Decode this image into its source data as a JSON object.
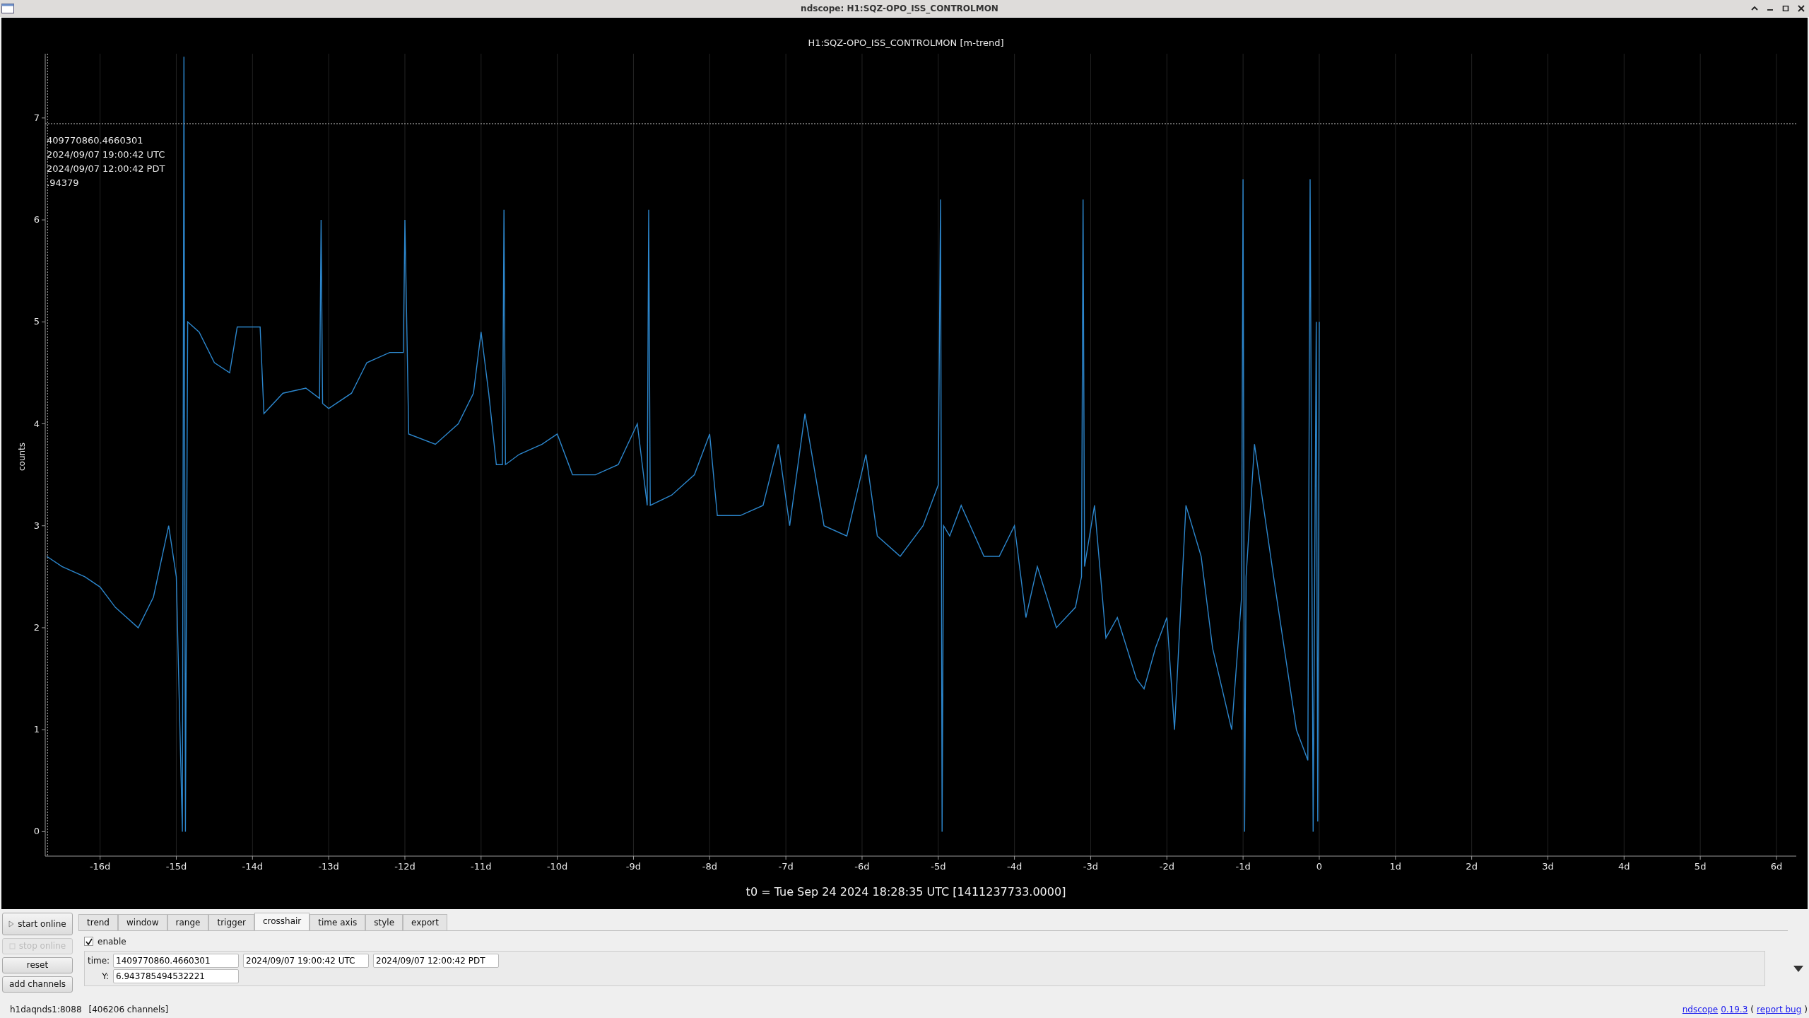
{
  "window": {
    "title": "ndscope: H1:SQZ-OPO_ISS_CONTROLMON"
  },
  "plot": {
    "crosshair_readouts": [
      "409770860.4660301",
      "2024/09/07 19:00:42 UTC",
      "2024/09/07 12:00:42 PDT",
      ".94379"
    ],
    "chart_data": {
      "type": "line",
      "title": "H1:SQZ-OPO_ISS_CONTROLMON [m-trend]",
      "ylabel": "counts",
      "xlabel": "t0 = Tue Sep 24 2024 18:28:35 UTC [1411237733.0000]",
      "xlim": [
        -16.72,
        6.26
      ],
      "ylim": [
        -0.24,
        7.63
      ],
      "yticks": [
        0,
        1,
        2,
        3,
        4,
        5,
        6,
        7
      ],
      "grid": true,
      "ref_lines": [
        {
          "axis": "y",
          "value": 6.9438
        },
        {
          "axis": "x",
          "value": -16.69
        }
      ],
      "xticks": [
        {
          "value": -16,
          "label": "-16d"
        },
        {
          "value": -15,
          "label": "-15d"
        },
        {
          "value": -14,
          "label": "-14d"
        },
        {
          "value": -13,
          "label": "-13d"
        },
        {
          "value": -12,
          "label": "-12d"
        },
        {
          "value": -11,
          "label": "-11d"
        },
        {
          "value": -10,
          "label": "-10d"
        },
        {
          "value": -9,
          "label": "-9d"
        },
        {
          "value": -8,
          "label": "-8d"
        },
        {
          "value": -7,
          "label": "-7d"
        },
        {
          "value": -6,
          "label": "-6d"
        },
        {
          "value": -5,
          "label": "-5d"
        },
        {
          "value": -4,
          "label": "-4d"
        },
        {
          "value": -3,
          "label": "-3d"
        },
        {
          "value": -2,
          "label": "-2d"
        },
        {
          "value": -1,
          "label": "-1d"
        },
        {
          "value": 0,
          "label": "0"
        },
        {
          "value": 1,
          "label": "1d"
        },
        {
          "value": 2,
          "label": "2d"
        },
        {
          "value": 3,
          "label": "3d"
        },
        {
          "value": 4,
          "label": "4d"
        },
        {
          "value": 5,
          "label": "5d"
        },
        {
          "value": 6,
          "label": "6d"
        }
      ],
      "x": [
        -16.7,
        -16.5,
        -16.2,
        -16,
        -15.8,
        -15.5,
        -15.3,
        -15.1,
        -15.0,
        -14.92,
        -14.9,
        -14.88,
        -14.85,
        -14.7,
        -14.5,
        -14.3,
        -14.2,
        -13.9,
        -13.85,
        -13.6,
        -13.3,
        -13.12,
        -13.1,
        -13.08,
        -13.0,
        -12.7,
        -12.5,
        -12.2,
        -12.02,
        -12.0,
        -11.95,
        -11.6,
        -11.3,
        -11.1,
        -11.0,
        -10.9,
        -10.8,
        -10.72,
        -10.7,
        -10.68,
        -10.5,
        -10.2,
        -10.0,
        -9.8,
        -9.5,
        -9.2,
        -8.95,
        -8.82,
        -8.8,
        -8.78,
        -8.5,
        -8.2,
        -8.0,
        -7.9,
        -7.6,
        -7.3,
        -7.1,
        -6.95,
        -6.75,
        -6.5,
        -6.2,
        -5.95,
        -5.8,
        -5.5,
        -5.2,
        -5.0,
        -4.97,
        -4.95,
        -4.93,
        -4.85,
        -4.7,
        -4.4,
        -4.2,
        -4.0,
        -3.85,
        -3.7,
        -3.45,
        -3.2,
        -3.12,
        -3.1,
        -3.08,
        -2.95,
        -2.8,
        -2.65,
        -2.4,
        -2.3,
        -2.15,
        -2.0,
        -1.9,
        -1.75,
        -1.55,
        -1.4,
        -1.15,
        -1.02,
        -1.0,
        -0.98,
        -0.96,
        -0.85,
        -0.6,
        -0.3,
        -0.15,
        -0.12,
        -0.08,
        -0.04,
        -0.02,
        0.0
      ],
      "series": [
        {
          "color": "#2c86cc",
          "values": [
            2.7,
            2.6,
            2.5,
            2.4,
            2.2,
            2.0,
            2.3,
            3.0,
            2.5,
            0.0,
            7.6,
            0.0,
            5.0,
            4.9,
            4.6,
            4.5,
            4.95,
            4.95,
            4.1,
            4.3,
            4.35,
            4.25,
            6.0,
            4.2,
            4.15,
            4.3,
            4.6,
            4.7,
            4.7,
            6.0,
            3.9,
            3.8,
            4.0,
            4.3,
            4.9,
            4.3,
            3.6,
            3.6,
            6.1,
            3.6,
            3.7,
            3.8,
            3.9,
            3.5,
            3.5,
            3.6,
            4.0,
            3.2,
            6.1,
            3.2,
            3.3,
            3.5,
            3.9,
            3.1,
            3.1,
            3.2,
            3.8,
            3.0,
            4.1,
            3.0,
            2.9,
            3.7,
            2.9,
            2.7,
            3.0,
            3.4,
            6.2,
            0.0,
            3.0,
            2.9,
            3.2,
            2.7,
            2.7,
            3.0,
            2.1,
            2.6,
            2.0,
            2.2,
            2.5,
            6.2,
            2.6,
            3.2,
            1.9,
            2.1,
            1.5,
            1.4,
            1.8,
            2.1,
            1.0,
            3.2,
            2.7,
            1.8,
            1.0,
            2.3,
            6.4,
            0.0,
            2.5,
            3.8,
            2.5,
            1.0,
            0.7,
            6.4,
            0.0,
            5.0,
            0.1,
            5.0
          ]
        }
      ]
    }
  },
  "side_buttons": [
    {
      "label": "start online",
      "kind": "start",
      "disabled": false
    },
    {
      "label": "stop online",
      "kind": "stop",
      "disabled": true
    },
    {
      "label": "reset",
      "kind": "plain",
      "disabled": false
    },
    {
      "label": "add channels",
      "kind": "plain",
      "disabled": false
    }
  ],
  "tabs": [
    {
      "label": "trend",
      "selected": false
    },
    {
      "label": "window",
      "selected": false
    },
    {
      "label": "range",
      "selected": false
    },
    {
      "label": "trigger",
      "selected": false
    },
    {
      "label": "crosshair",
      "selected": true
    },
    {
      "label": "time axis",
      "selected": false
    },
    {
      "label": "style",
      "selected": false
    },
    {
      "label": "export",
      "selected": false
    }
  ],
  "crosshair": {
    "enable": {
      "label": "enable",
      "checked": true
    },
    "time_label": "time:",
    "time_fields": [
      "1409770860.4660301",
      "2024/09/07 19:00:42 UTC",
      "2024/09/07 12:00:42 PDT"
    ],
    "y_label": "Y:",
    "y_value": "6.943785494532221"
  },
  "status_bar": {
    "server": "h1daqnds1:8088",
    "channels": "[406206 channels]",
    "links": [
      "ndscope",
      "0.19.3"
    ],
    "paren_open": "(",
    "report_link": "report bug",
    "paren_close": ")"
  }
}
